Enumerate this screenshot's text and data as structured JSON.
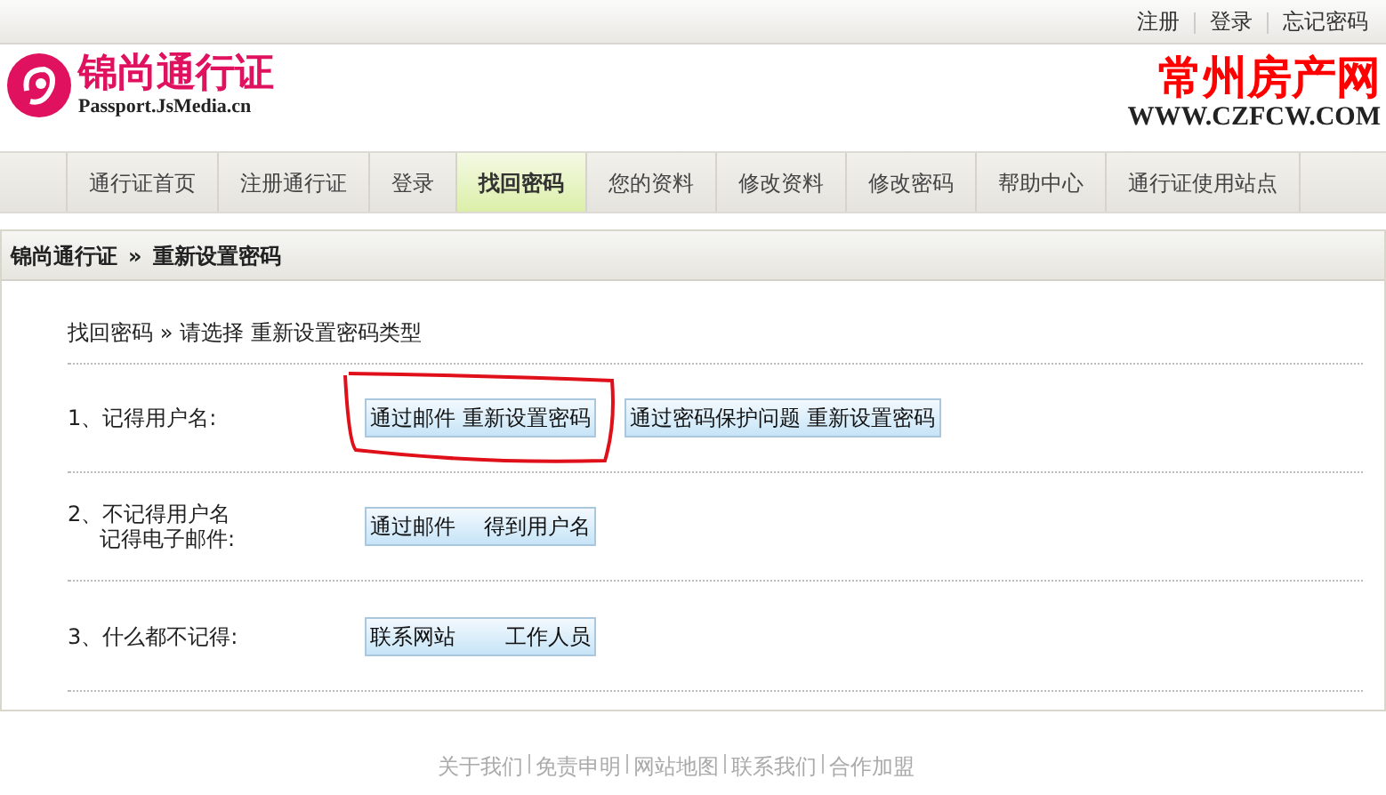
{
  "top_links": [
    "注册",
    "登录",
    "忘记密码"
  ],
  "logo": {
    "title": "锦尚通行证",
    "subtitle": "Passport.JsMedia.cn"
  },
  "partner_logo": {
    "title": "常州房产网",
    "subtitle": "WWW.CZFCW.COM"
  },
  "nav": [
    {
      "label": "通行证首页",
      "selected": false
    },
    {
      "label": "注册通行证",
      "selected": false
    },
    {
      "label": "登录",
      "selected": false
    },
    {
      "label": "找回密码",
      "selected": true
    },
    {
      "label": "您的资料",
      "selected": false
    },
    {
      "label": "修改资料",
      "selected": false
    },
    {
      "label": "修改密码",
      "selected": false
    },
    {
      "label": "帮助中心",
      "selected": false
    },
    {
      "label": "通行证使用站点",
      "selected": false
    }
  ],
  "breadcrumb": {
    "site": "锦尚通行证",
    "separator": "»",
    "page": "重新设置密码"
  },
  "subtitle": "找回密码 » 请选择 重新设置密码类型",
  "options": [
    {
      "label": [
        "1、记得用户名:"
      ],
      "buttons": [
        {
          "label": "通过邮件 重新设置密码",
          "highlighted": true
        },
        {
          "label": "通过密码保护问题 重新设置密码",
          "highlighted": false
        }
      ]
    },
    {
      "label": [
        "2、不记得用户名",
        "记得电子邮件:"
      ],
      "buttons": [
        {
          "label": "通过邮件　 得到用户名",
          "highlighted": false
        }
      ]
    },
    {
      "label": [
        "3、什么都不记得:"
      ],
      "buttons": [
        {
          "label": "联系网站　　 工作人员",
          "highlighted": false
        }
      ]
    }
  ],
  "footer_links": [
    "关于我们",
    "免责申明",
    "网站地图",
    "联系我们",
    "合作加盟"
  ]
}
